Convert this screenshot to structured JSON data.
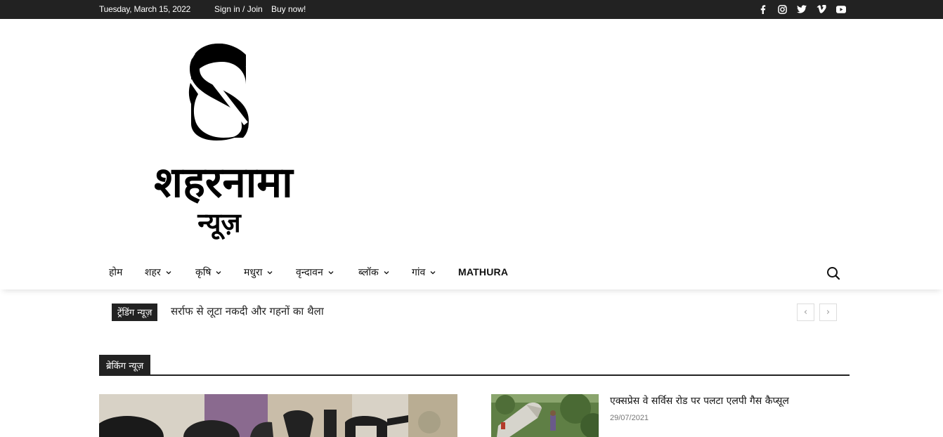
{
  "topbar": {
    "date": "Tuesday, March 15, 2022",
    "signin_label": "Sign in / Join",
    "buy_label": "Buy now!",
    "social": [
      "facebook-icon",
      "instagram-icon",
      "twitter-icon",
      "vimeo-icon",
      "youtube-icon"
    ]
  },
  "logo": {
    "line1": "शहरनामा",
    "line2": "न्यूज़"
  },
  "nav": {
    "items": [
      {
        "label": "होम",
        "dropdown": false
      },
      {
        "label": "शहर",
        "dropdown": true
      },
      {
        "label": "कृषि",
        "dropdown": true
      },
      {
        "label": "मधुरा",
        "dropdown": true
      },
      {
        "label": "वृन्दावन",
        "dropdown": true
      },
      {
        "label": "ब्लॉक",
        "dropdown": true
      },
      {
        "label": "गांव",
        "dropdown": true
      },
      {
        "label": "MATHURA",
        "dropdown": false
      }
    ]
  },
  "trending": {
    "label": "ट्रेंडिंग न्यूज़",
    "headline": "सर्राफ से लूटा नकदी और गहनों का थैला",
    "prev": "‹",
    "next": "›"
  },
  "breaking": {
    "title": "ब्रेकिंग न्यूज़",
    "articles": [
      {
        "title": "एक्सप्रेस वे सर्विस रोड पर पलटा एलपी गैस कैप्सूल",
        "date": "29/07/2021"
      }
    ]
  },
  "colors": {
    "dark": "#222222",
    "meta": "#767676"
  }
}
